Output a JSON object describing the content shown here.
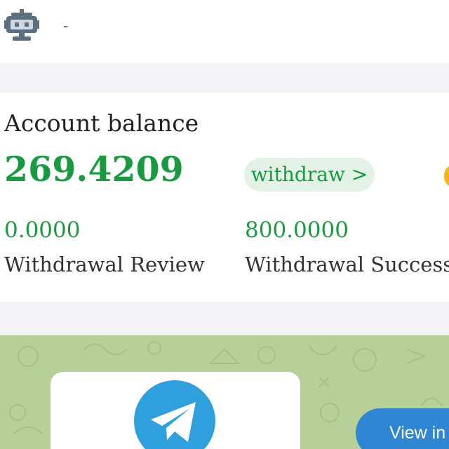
{
  "header": {
    "avatar_icon": "robot-icon",
    "user_name": "-"
  },
  "balance": {
    "title": "Account balance",
    "amount": "269.4209",
    "withdraw_label": "withdraw >",
    "stats": [
      {
        "value": "0.0000",
        "label": "Withdrawal Review"
      },
      {
        "value": "800.0000",
        "label": "Withdrawal Success"
      }
    ]
  },
  "banner": {
    "icon": "telegram-icon",
    "button_label": "View in"
  },
  "colors": {
    "accent_green": "#1a9a40",
    "pill_bg": "#e4f1e6",
    "banner_bg": "#b9cf9a",
    "telegram_blue": "#2f9fde",
    "button_blue": "#2f86d2"
  }
}
